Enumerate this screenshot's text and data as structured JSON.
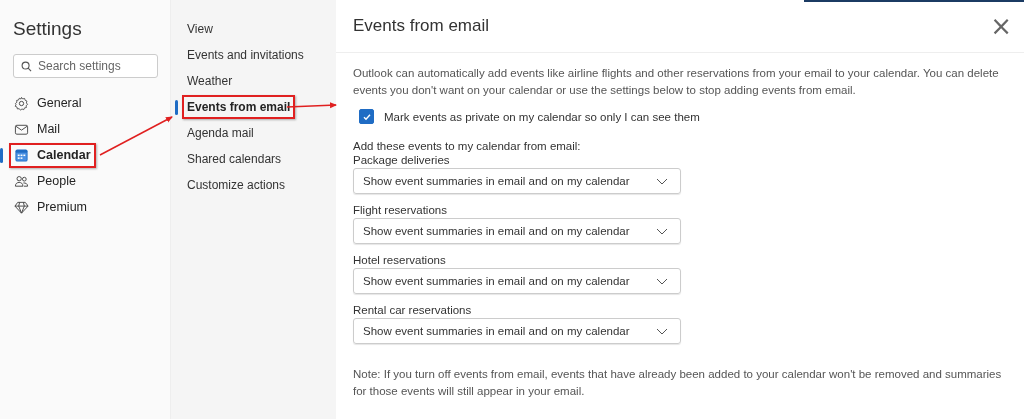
{
  "sidebar": {
    "title": "Settings",
    "search": {
      "placeholder": "Search settings"
    },
    "items": [
      {
        "label": "General",
        "selected": false,
        "annotated": false
      },
      {
        "label": "Mail",
        "selected": false,
        "annotated": false
      },
      {
        "label": "Calendar",
        "selected": true,
        "annotated": true
      },
      {
        "label": "People",
        "selected": false,
        "annotated": false
      },
      {
        "label": "Premium",
        "selected": false,
        "annotated": false
      }
    ]
  },
  "subnav": {
    "items": [
      {
        "label": "View",
        "selected": false,
        "annotated": false
      },
      {
        "label": "Events and invitations",
        "selected": false,
        "annotated": false
      },
      {
        "label": "Weather",
        "selected": false,
        "annotated": false
      },
      {
        "label": "Events from email",
        "selected": true,
        "annotated": true
      },
      {
        "label": "Agenda mail",
        "selected": false,
        "annotated": false
      },
      {
        "label": "Shared calendars",
        "selected": false,
        "annotated": false
      },
      {
        "label": "Customize actions",
        "selected": false,
        "annotated": false
      }
    ]
  },
  "panel": {
    "title": "Events from email",
    "close": "×",
    "intro": "Outlook can automatically add events like airline flights and other reservations from your email to your calendar. You can delete events you don't want on your calendar or use the settings below to stop adding events from email.",
    "checkbox": {
      "label": "Mark events as private on my calendar so only I can see them",
      "checked": true
    },
    "section_label": "Add these events to my calendar from email:",
    "dropdowns": [
      {
        "label": "Package deliveries",
        "value": "Show event summaries in email and on my calendar"
      },
      {
        "label": "Flight reservations",
        "value": "Show event summaries in email and on my calendar"
      },
      {
        "label": "Hotel reservations",
        "value": "Show event summaries in email and on my calendar"
      },
      {
        "label": "Rental car reservations",
        "value": "Show event summaries in email and on my calendar"
      }
    ],
    "note": "Note: If you turn off events from email, events that have already been added to your calendar won't be removed and summaries for those events will still appear in your email."
  }
}
